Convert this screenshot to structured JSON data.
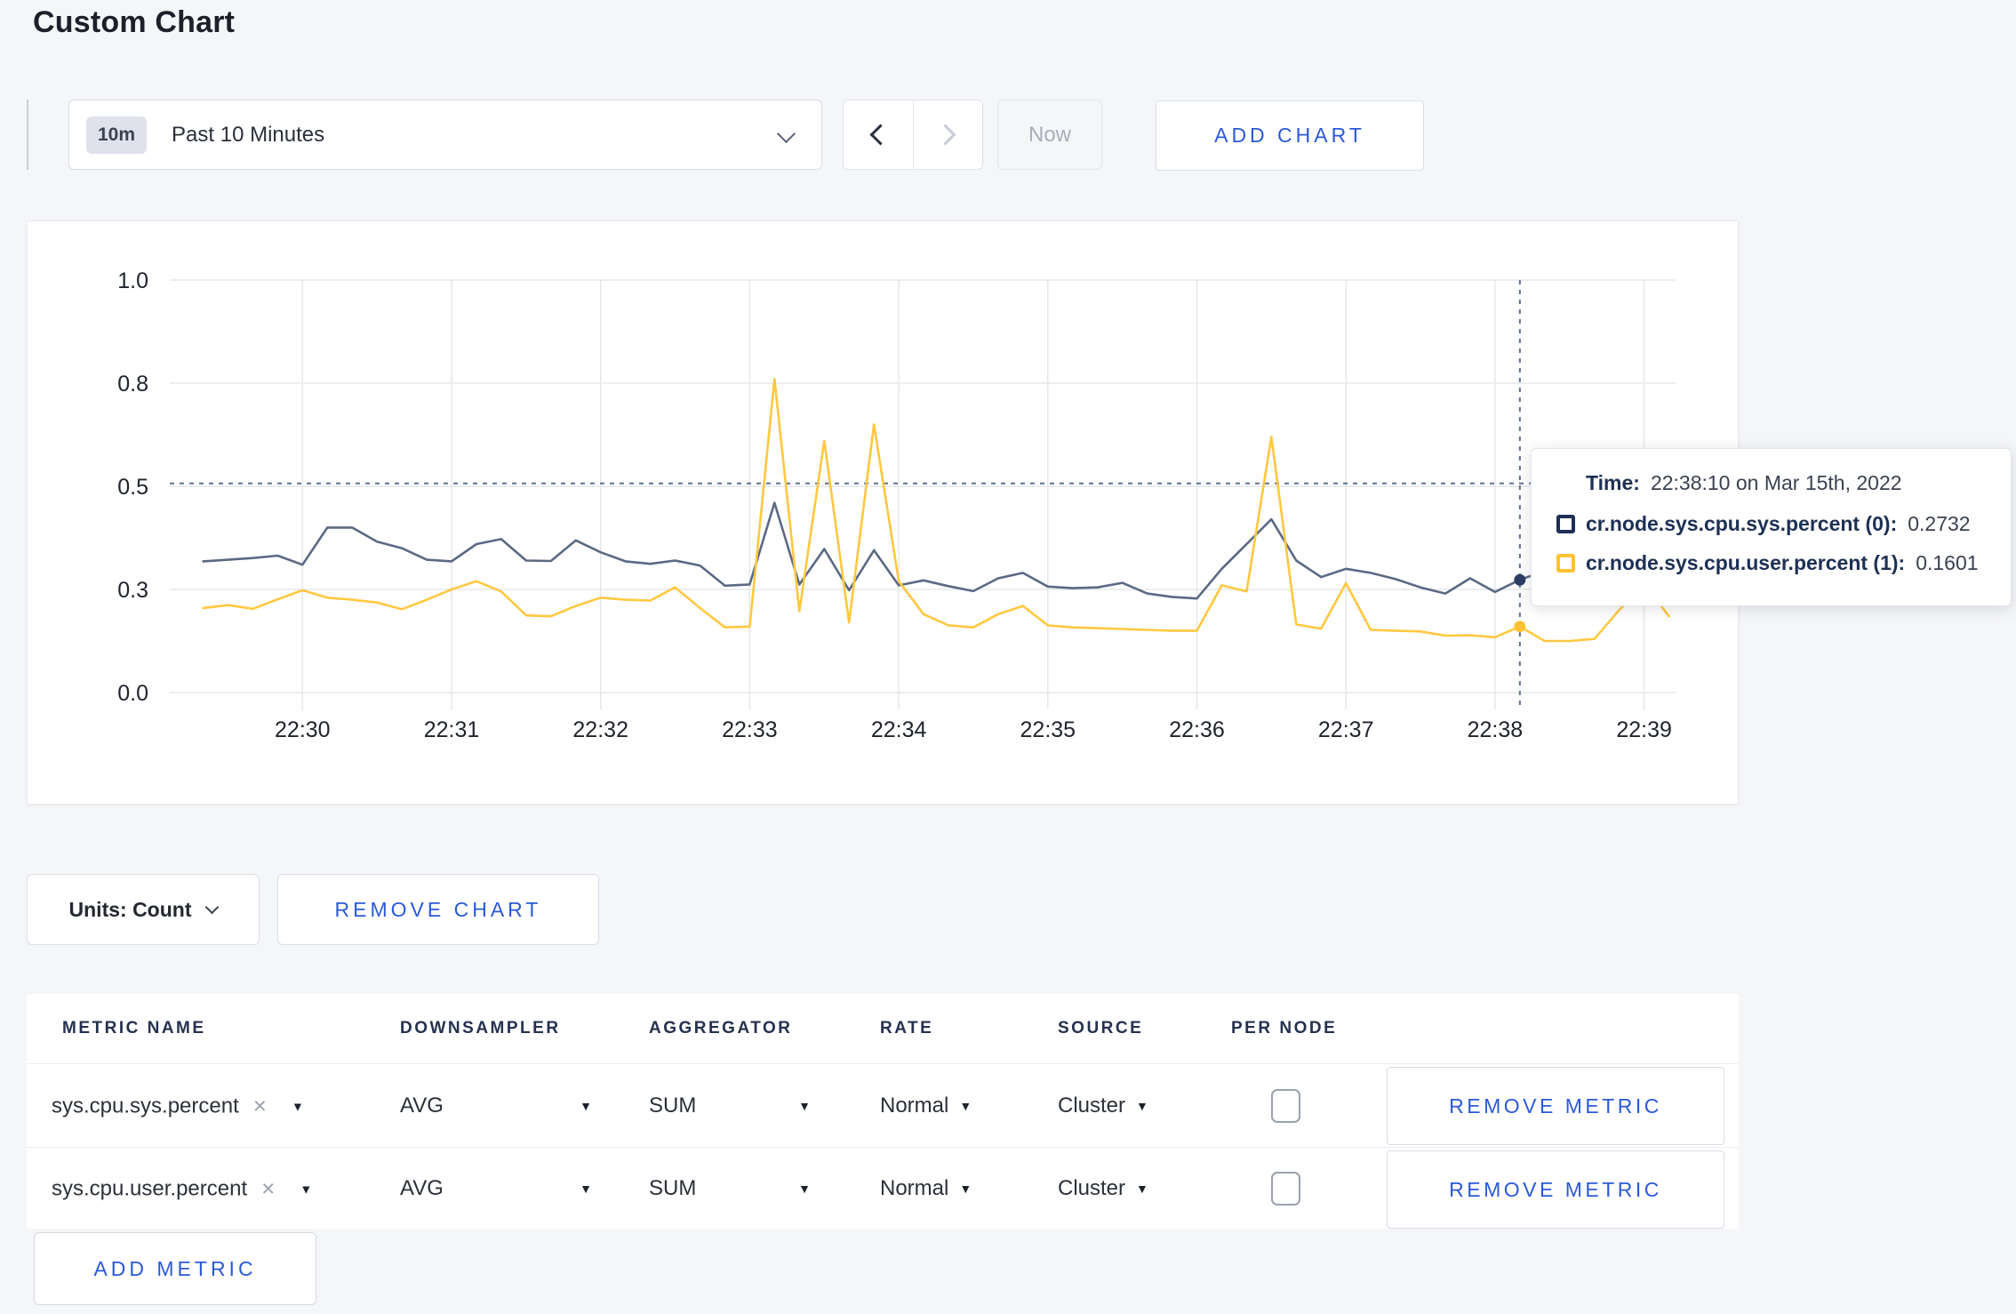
{
  "page": {
    "title": "Custom Chart"
  },
  "toolbar": {
    "time_window": {
      "badge": "10m",
      "label": "Past 10 Minutes"
    },
    "now_label": "Now",
    "add_chart_label": "ADD CHART"
  },
  "chart_controls": {
    "units_label": "Units: Count",
    "remove_chart_label": "REMOVE CHART"
  },
  "tooltip": {
    "time_label": "Time:",
    "time_value": "22:38:10 on Mar 15th, 2022",
    "rows": [
      {
        "label": "cr.node.sys.cpu.sys.percent (0):",
        "value": "0.2732",
        "color": "#1c2f55"
      },
      {
        "label": "cr.node.sys.cpu.user.percent (1):",
        "value": "0.1601",
        "color": "#ffc234"
      }
    ]
  },
  "metrics_table": {
    "headers": [
      "METRIC NAME",
      "DOWNSAMPLER",
      "AGGREGATOR",
      "RATE",
      "SOURCE",
      "PER NODE"
    ],
    "rows": [
      {
        "metric": "sys.cpu.sys.percent",
        "downsampler": "AVG",
        "aggregator": "SUM",
        "rate": "Normal",
        "source": "Cluster",
        "per_node_checked": false,
        "remove_label": "REMOVE METRIC"
      },
      {
        "metric": "sys.cpu.user.percent",
        "downsampler": "AVG",
        "aggregator": "SUM",
        "rate": "Normal",
        "source": "Cluster",
        "per_node_checked": false,
        "remove_label": "REMOVE METRIC"
      }
    ],
    "add_metric_label": "ADD METRIC",
    "icons": {
      "remove_name": "×",
      "dropdown_caret": "▼"
    }
  },
  "chart_data": {
    "type": "line",
    "title": "",
    "xlabel": "",
    "ylabel": "",
    "grid": true,
    "legend_position": "tooltip",
    "y_axis": {
      "range": [
        0,
        1
      ],
      "ticks": [
        {
          "value": 0,
          "label": "0.0"
        },
        {
          "value": 0.25,
          "label": "0.3"
        },
        {
          "value": 0.5,
          "label": "0.5"
        },
        {
          "value": 0.75,
          "label": "0.8"
        },
        {
          "value": 1,
          "label": "1.0"
        }
      ]
    },
    "x_axis": {
      "tick_labels": [
        "22:30",
        "22:31",
        "22:32",
        "22:33",
        "22:34",
        "22:35",
        "22:36",
        "22:37",
        "22:38",
        "22:39"
      ],
      "tick_offsets_sec": [
        0,
        60,
        120,
        180,
        240,
        300,
        360,
        420,
        480,
        540
      ]
    },
    "sample_start_offset_sec": -40,
    "sample_step_sec": 10,
    "series": [
      {
        "name": "cr.node.sys.cpu.sys.percent",
        "color": "#5b6984",
        "values": [
          0.318,
          0.322,
          0.326,
          0.332,
          0.31,
          0.4,
          0.4,
          0.366,
          0.35,
          0.322,
          0.318,
          0.36,
          0.372,
          0.32,
          0.319,
          0.369,
          0.34,
          0.318,
          0.312,
          0.32,
          0.308,
          0.259,
          0.262,
          0.46,
          0.262,
          0.348,
          0.248,
          0.345,
          0.26,
          0.272,
          0.258,
          0.246,
          0.277,
          0.29,
          0.257,
          0.253,
          0.255,
          0.266,
          0.24,
          0.232,
          0.228,
          0.3,
          0.36,
          0.42,
          0.32,
          0.28,
          0.3,
          0.29,
          0.275,
          0.255,
          0.24,
          0.277,
          0.244,
          0.2732,
          0.295,
          0.31,
          0.3,
          0.29,
          0.295,
          0.3
        ]
      },
      {
        "name": "cr.node.sys.cpu.user.percent",
        "color": "#ffc840",
        "values": [
          0.205,
          0.212,
          0.203,
          0.226,
          0.248,
          0.23,
          0.225,
          0.218,
          0.202,
          0.225,
          0.25,
          0.27,
          0.245,
          0.187,
          0.185,
          0.21,
          0.23,
          0.225,
          0.223,
          0.255,
          0.205,
          0.158,
          0.16,
          0.76,
          0.197,
          0.61,
          0.17,
          0.65,
          0.27,
          0.19,
          0.163,
          0.158,
          0.19,
          0.21,
          0.163,
          0.158,
          0.156,
          0.154,
          0.152,
          0.15,
          0.15,
          0.26,
          0.245,
          0.62,
          0.165,
          0.155,
          0.265,
          0.152,
          0.15,
          0.148,
          0.138,
          0.139,
          0.134,
          0.1601,
          0.125,
          0.125,
          0.13,
          0.2,
          0.265,
          0.185
        ]
      }
    ],
    "crosshair": {
      "x_offset_sec": 490,
      "y_value": 0.507,
      "color": "#5d7191"
    },
    "hover_markers": [
      {
        "series": 0,
        "x_offset_sec": 490,
        "value": 0.2732,
        "color": "#2c3e63"
      },
      {
        "series": 1,
        "x_offset_sec": 490,
        "value": 0.1601,
        "color": "#ffc234"
      }
    ]
  }
}
